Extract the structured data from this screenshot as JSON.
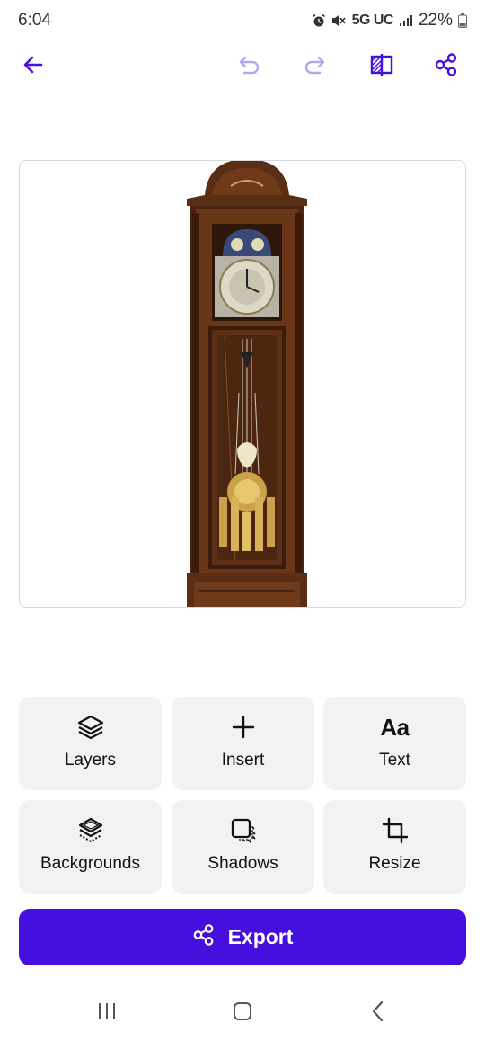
{
  "status_bar": {
    "time": "6:04",
    "network": "5G UC",
    "battery": "22%",
    "icons": [
      "alarm-icon",
      "mute-icon",
      "signal-icon",
      "battery-icon"
    ]
  },
  "toolbar": {
    "icons": [
      "back-arrow-icon",
      "undo-icon",
      "redo-icon",
      "compare-icon",
      "share-icon"
    ],
    "accent_color": "#4510de",
    "disabled_color": "#b7a6ea"
  },
  "canvas": {
    "image_subject": "grandfather clock"
  },
  "tools": [
    {
      "label": "Layers",
      "icon": "layers-icon"
    },
    {
      "label": "Insert",
      "icon": "plus-icon"
    },
    {
      "label": "Text",
      "icon": "text-aa-icon",
      "glyph": "Aa"
    },
    {
      "label": "Backgrounds",
      "icon": "backgrounds-icon"
    },
    {
      "label": "Shadows",
      "icon": "shadows-icon"
    },
    {
      "label": "Resize",
      "icon": "crop-icon"
    }
  ],
  "export": {
    "label": "Export",
    "icon": "share-icon",
    "color": "#4510de"
  },
  "nav_bar": {
    "icons": [
      "recents-icon",
      "home-icon",
      "back-icon"
    ]
  }
}
